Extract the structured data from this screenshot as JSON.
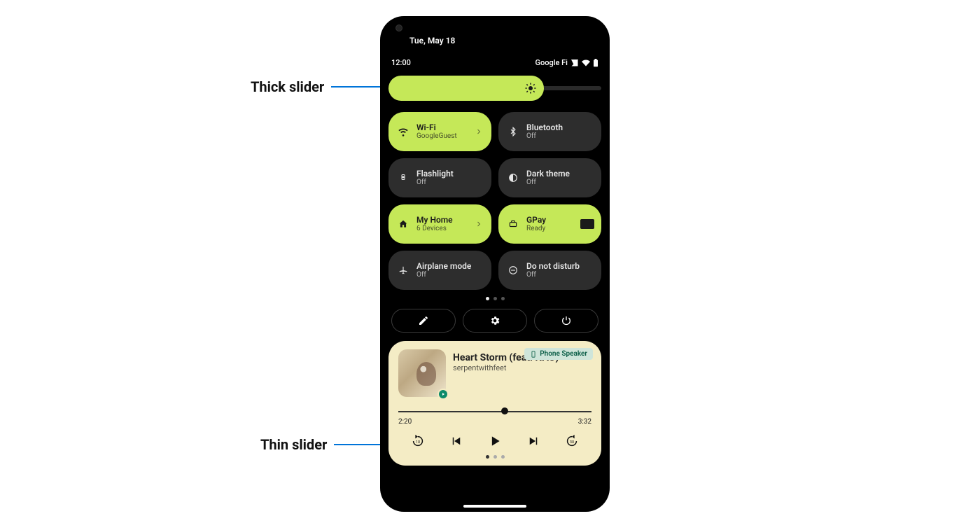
{
  "annotations": {
    "thick": "Thick slider",
    "thin": "Thin slider"
  },
  "status": {
    "date": "Tue, May 18",
    "time": "12:00",
    "carrier": "Google Fi"
  },
  "brightness": {
    "percent": 73
  },
  "tiles": [
    {
      "title": "Wi-Fi",
      "sub": "GoogleGuest",
      "on": true,
      "icon": "wifi",
      "chevron": true
    },
    {
      "title": "Bluetooth",
      "sub": "Off",
      "on": false,
      "icon": "bluetooth",
      "chevron": false
    },
    {
      "title": "Flashlight",
      "sub": "Off",
      "on": false,
      "icon": "flash",
      "chevron": false
    },
    {
      "title": "Dark theme",
      "sub": "Off",
      "on": false,
      "icon": "dark",
      "chevron": false
    },
    {
      "title": "My Home",
      "sub": "6 Devices",
      "on": true,
      "icon": "home",
      "chevron": true
    },
    {
      "title": "GPay",
      "sub": "Ready",
      "on": true,
      "icon": "gpay",
      "card": true
    },
    {
      "title": "Airplane mode",
      "sub": "Off",
      "on": false,
      "icon": "airplane",
      "chevron": false
    },
    {
      "title": "Do not disturb",
      "sub": "Off",
      "on": false,
      "icon": "dnd",
      "chevron": false
    }
  ],
  "media": {
    "output": "Phone Speaker",
    "title": "Heart Storm (feat. NAO)",
    "artist": "serpentwithfeet",
    "elapsed": "2:20",
    "total": "3:32",
    "progress_percent": 55,
    "replay_label": "10",
    "forward_label": "30"
  }
}
